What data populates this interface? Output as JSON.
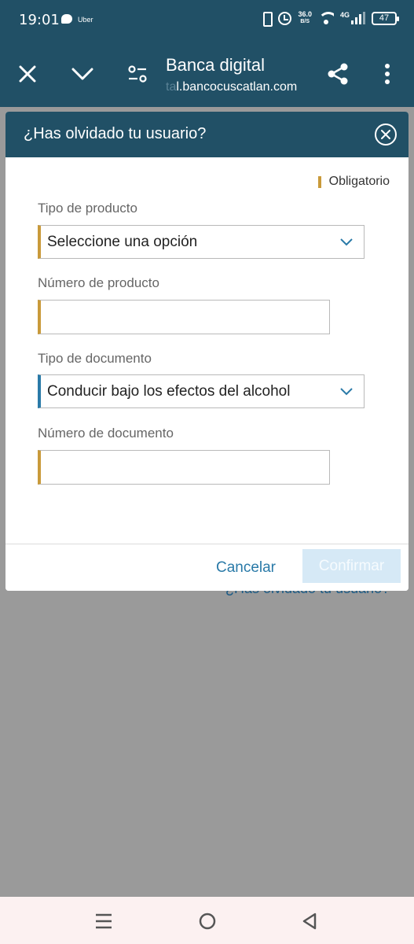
{
  "status_bar": {
    "time": "19:01",
    "app_label": "Uber",
    "speed_value": "36.0",
    "speed_unit": "B/S",
    "network": "4G",
    "battery": "47"
  },
  "browser": {
    "title": "Banca digital",
    "url_faded": "ta",
    "url": "l.bancocuscatlan.com"
  },
  "dialog": {
    "title": "¿Has olvidado tu usuario?",
    "required_label": "Obligatorio",
    "fields": {
      "product_type": {
        "label": "Tipo de producto",
        "value": "Seleccione una opción"
      },
      "product_number": {
        "label": "Número de producto",
        "value": ""
      },
      "document_type": {
        "label": "Tipo de documento",
        "value": "Conducir bajo los efectos del alcohol"
      },
      "document_number": {
        "label": "Número de documento",
        "value": ""
      }
    },
    "cancel_label": "Cancelar",
    "confirm_label": "Confirmar"
  },
  "background": {
    "forgot_link": "¿Has olvidado tu usuario?"
  },
  "colors": {
    "header": "#215066",
    "required_accent": "#c99a3a",
    "active_accent": "#2a7aa8",
    "overlay": "#9a9a9a"
  },
  "icons": [
    "close-icon",
    "chevron-down-icon",
    "tune-icon",
    "share-icon",
    "more-vert-icon",
    "circle-close-icon",
    "menu-icon",
    "home-icon",
    "back-icon"
  ]
}
